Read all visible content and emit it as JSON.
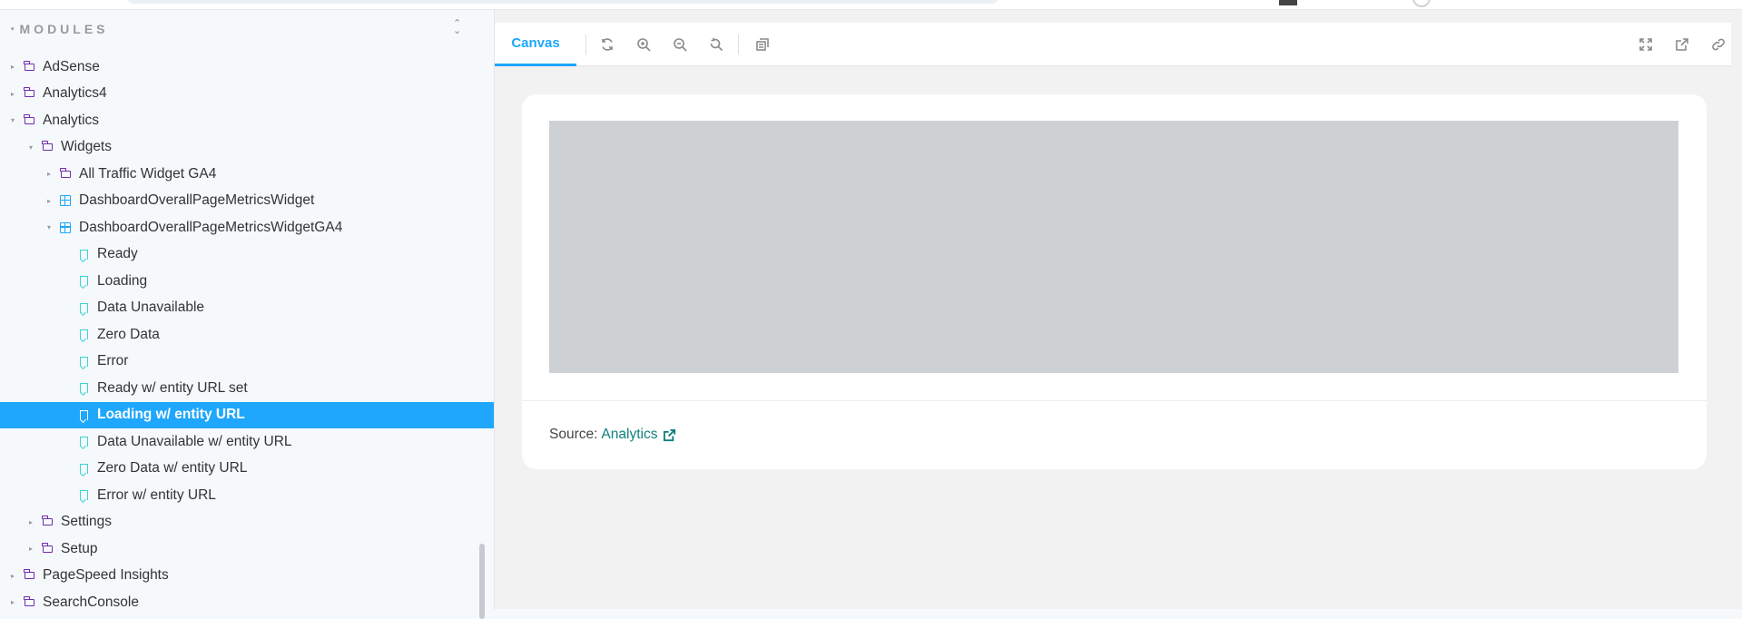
{
  "sidebar": {
    "header": "MODULES",
    "tree": [
      {
        "label": "AdSense",
        "kind": "folder",
        "level": 0,
        "arrow": "▸"
      },
      {
        "label": "Analytics4",
        "kind": "folder",
        "level": 0,
        "arrow": "▸"
      },
      {
        "label": "Analytics",
        "kind": "folder",
        "level": 0,
        "arrow": "▾"
      },
      {
        "label": "Widgets",
        "kind": "folder",
        "level": 1,
        "arrow": "▾"
      },
      {
        "label": "All Traffic Widget GA4",
        "kind": "folder",
        "level": 2,
        "arrow": "▸"
      },
      {
        "label": "DashboardOverallPageMetricsWidget",
        "kind": "component",
        "level": 2,
        "arrow": "▸"
      },
      {
        "label": "DashboardOverallPageMetricsWidgetGA4",
        "kind": "component",
        "level": 2,
        "arrow": "▾"
      },
      {
        "label": "Ready",
        "kind": "story",
        "level": 3,
        "arrow": ""
      },
      {
        "label": "Loading",
        "kind": "story",
        "level": 3,
        "arrow": ""
      },
      {
        "label": "Data Unavailable",
        "kind": "story",
        "level": 3,
        "arrow": ""
      },
      {
        "label": "Zero Data",
        "kind": "story",
        "level": 3,
        "arrow": ""
      },
      {
        "label": "Error",
        "kind": "story",
        "level": 3,
        "arrow": ""
      },
      {
        "label": "Ready w/ entity URL set",
        "kind": "story",
        "level": 3,
        "arrow": ""
      },
      {
        "label": "Loading w/ entity URL",
        "kind": "story",
        "level": 3,
        "arrow": "",
        "selected": true
      },
      {
        "label": "Data Unavailable w/ entity URL",
        "kind": "story",
        "level": 3,
        "arrow": ""
      },
      {
        "label": "Zero Data w/ entity URL",
        "kind": "story",
        "level": 3,
        "arrow": ""
      },
      {
        "label": "Error w/ entity URL",
        "kind": "story",
        "level": 3,
        "arrow": ""
      },
      {
        "label": "Settings",
        "kind": "folder",
        "level": 1,
        "arrow": "▸"
      },
      {
        "label": "Setup",
        "kind": "folder",
        "level": 1,
        "arrow": "▸"
      },
      {
        "label": "PageSpeed Insights",
        "kind": "folder",
        "level": 0,
        "arrow": "▸"
      },
      {
        "label": "SearchConsole",
        "kind": "folder",
        "level": 0,
        "arrow": "▸"
      }
    ]
  },
  "toolbar": {
    "tab_canvas": "Canvas",
    "left_icons": [
      "refresh-icon",
      "zoom-in-icon",
      "zoom-out-icon",
      "zoom-reset-icon",
      "background-icon"
    ],
    "right_icons": [
      "fullscreen-icon",
      "open-new-tab-icon",
      "copy-link-icon"
    ]
  },
  "canvas": {
    "source_prefix": "Source:",
    "source_link": "Analytics",
    "source_link_icon": "external-link-icon"
  },
  "colors": {
    "accent": "#1ea7fd",
    "folder": "#6f2cac",
    "story": "#37d5d3",
    "link": "#108080",
    "placeholder": "#ced1d4"
  }
}
